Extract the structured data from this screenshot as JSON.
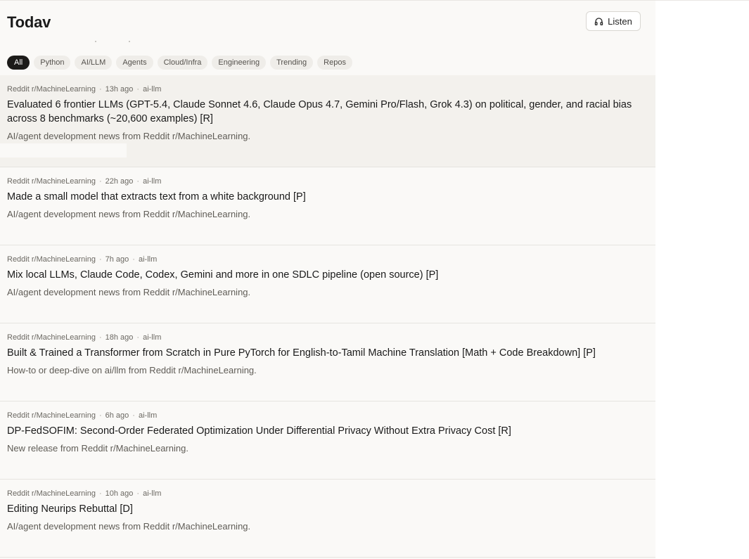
{
  "page": {
    "title": "Todav",
    "listen_label": "Listen",
    "colors": {
      "background": "#faf9f7",
      "active_chip": "#1c1b19",
      "chip": "#efede9",
      "highlight_row": "#f3f1ed"
    }
  },
  "filters": [
    {
      "label": "All",
      "active": true
    },
    {
      "label": "Python",
      "active": false
    },
    {
      "label": "AI/LLM",
      "active": false
    },
    {
      "label": "Agents",
      "active": false
    },
    {
      "label": "Cloud/Infra",
      "active": false
    },
    {
      "label": "Engineering",
      "active": false
    },
    {
      "label": "Trending",
      "active": false
    },
    {
      "label": "Repos",
      "active": false
    }
  ],
  "items": [
    {
      "source": "Reddit r/MachineLearning",
      "time": "13h ago",
      "tag": "ai-llm",
      "title": "Evaluated 6 frontier LLMs (GPT-5.4, Claude Sonnet 4.6, Claude Opus 4.7, Gemini Pro/Flash, Grok 4.3) on political, gender, and racial bias across 8 benchmarks (~20,600 examples) [R]",
      "description": "AI/agent development news from Reddit r/MachineLearning.",
      "highlighted": true
    },
    {
      "source": "Reddit r/MachineLearning",
      "time": "22h ago",
      "tag": "ai-llm",
      "title": "Made a small model that extracts text from a white background [P]",
      "description": "AI/agent development news from Reddit r/MachineLearning.",
      "highlighted": false
    },
    {
      "source": "Reddit r/MachineLearning",
      "time": "7h ago",
      "tag": "ai-llm",
      "title": "Mix local LLMs, Claude Code, Codex, Gemini and more in one SDLC pipeline (open source) [P]",
      "description": "AI/agent development news from Reddit r/MachineLearning.",
      "highlighted": false
    },
    {
      "source": "Reddit r/MachineLearning",
      "time": "18h ago",
      "tag": "ai-llm",
      "title": "Built & Trained a Transformer from Scratch in Pure PyTorch for English-to-Tamil Machine Translation [Math + Code Breakdown] [P]",
      "description": "How-to or deep-dive on ai/llm from Reddit r/MachineLearning.",
      "highlighted": false
    },
    {
      "source": "Reddit r/MachineLearning",
      "time": "6h ago",
      "tag": "ai-llm",
      "title": "DP-FedSOFIM: Second-Order Federated Optimization Under Differential Privacy Without Extra Privacy Cost [R]",
      "description": "New release from Reddit r/MachineLearning.",
      "highlighted": false
    },
    {
      "source": "Reddit r/MachineLearning",
      "time": "10h ago",
      "tag": "ai-llm",
      "title": "Editing Neurips Rebuttal [D]",
      "description": "AI/agent development news from Reddit r/MachineLearning.",
      "highlighted": false
    }
  ]
}
